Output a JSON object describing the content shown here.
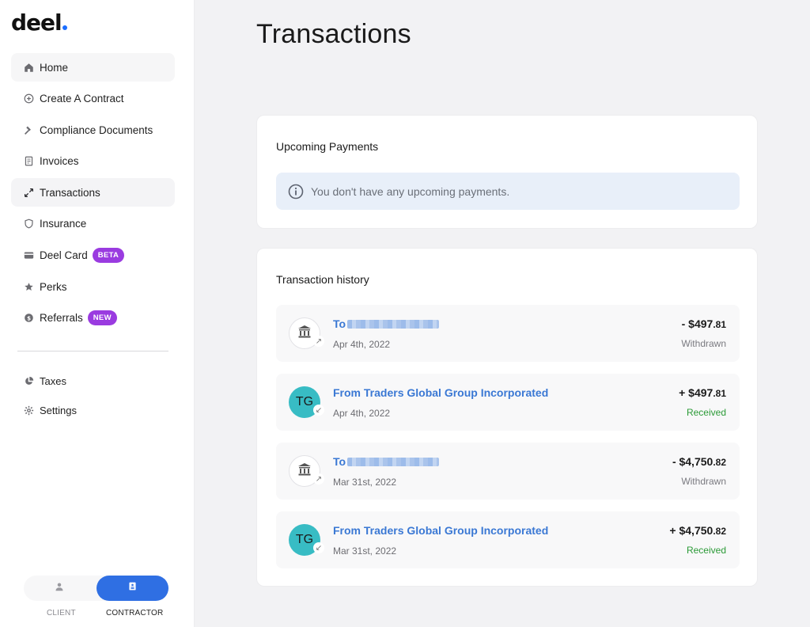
{
  "brand": {
    "name": "deel",
    "dot_color": "#1a6dff"
  },
  "colors": {
    "accent": "#2f6fe3",
    "link": "#3a78d4",
    "received": "#2a9a36",
    "withdrawn": "#7a7a80",
    "beta_badge": "#9a3be0",
    "new_badge": "#9a3be0",
    "avatar_teal": "#38bcc4"
  },
  "sidebar": {
    "items": [
      {
        "label": "Home",
        "icon": "home-icon"
      },
      {
        "label": "Create A Contract",
        "icon": "plus-circle-icon"
      },
      {
        "label": "Compliance Documents",
        "icon": "hammer-icon"
      },
      {
        "label": "Invoices",
        "icon": "document-icon"
      },
      {
        "label": "Transactions",
        "icon": "transfer-arrows-icon",
        "active": true
      },
      {
        "label": "Insurance",
        "icon": "shield-icon"
      },
      {
        "label": "Deel Card",
        "icon": "card-icon",
        "badge": "BETA"
      },
      {
        "label": "Perks",
        "icon": "star-icon"
      },
      {
        "label": "Referrals",
        "icon": "dollar-coin-icon",
        "badge": "NEW"
      }
    ],
    "secondary": [
      {
        "label": "Taxes",
        "icon": "pie-chart-icon"
      },
      {
        "label": "Settings",
        "icon": "gear-icon"
      }
    ],
    "role_switch": {
      "client": "CLIENT",
      "contractor": "CONTRACTOR",
      "selected": "contractor"
    }
  },
  "main": {
    "title": "Transactions",
    "upcoming": {
      "title": "Upcoming Payments",
      "empty_message": "You don't have any upcoming payments."
    },
    "history": {
      "title": "Transaction history",
      "transactions": [
        {
          "type": "withdrawal",
          "avatar": "bank-icon",
          "name": "To",
          "redacted": true,
          "date": "Apr 4th, 2022",
          "amount": "- $497",
          "cents": ".81",
          "status": "Withdrawn"
        },
        {
          "type": "deposit",
          "avatar": "TG",
          "name": "From Traders Global Group Incorporated",
          "redacted": false,
          "date": "Apr 4th, 2022",
          "amount": "+ $497",
          "cents": ".81",
          "status": "Received"
        },
        {
          "type": "withdrawal",
          "avatar": "bank-icon",
          "name": "To",
          "redacted": true,
          "date": "Mar 31st, 2022",
          "amount": "- $4,750",
          "cents": ".82",
          "status": "Withdrawn"
        },
        {
          "type": "deposit",
          "avatar": "TG",
          "name": "From Traders Global Group Incorporated",
          "redacted": false,
          "date": "Mar 31st, 2022",
          "amount": "+ $4,750",
          "cents": ".82",
          "status": "Received"
        }
      ]
    }
  }
}
